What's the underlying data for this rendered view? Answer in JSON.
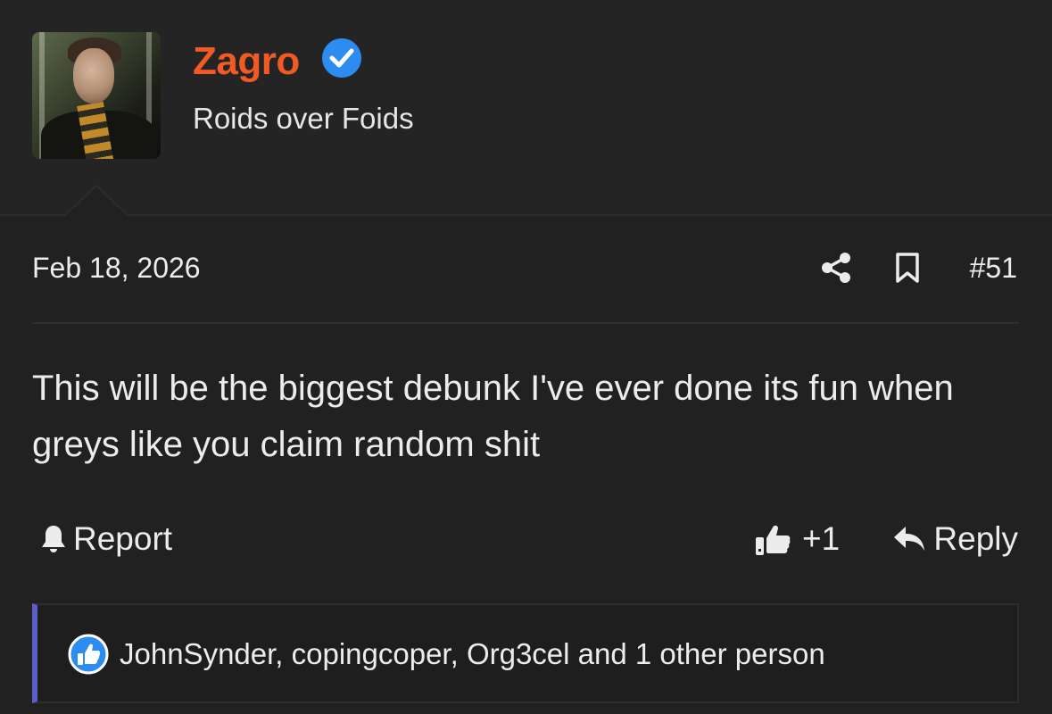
{
  "user": {
    "name": "Zagro",
    "title": "Roids over Foids",
    "verified": true,
    "name_color": "#f15a24",
    "verified_color": "#2d8cf0"
  },
  "post": {
    "date": "Feb 18, 2026",
    "number": "#51",
    "body": "This will be the biggest debunk I've ever done its fun when greys like you claim random shit"
  },
  "actions": {
    "report_label": "Report",
    "like_count": "+1",
    "reply_label": "Reply"
  },
  "reactions": {
    "text": "JohnSynder, copingcoper, Org3cel and 1 other person",
    "accent_color": "#5b5fc7"
  },
  "icons": [
    "verified-icon",
    "share-icon",
    "bookmark-icon",
    "bell-icon",
    "thumbs-up-icon",
    "reply-icon",
    "reaction-like-icon"
  ]
}
